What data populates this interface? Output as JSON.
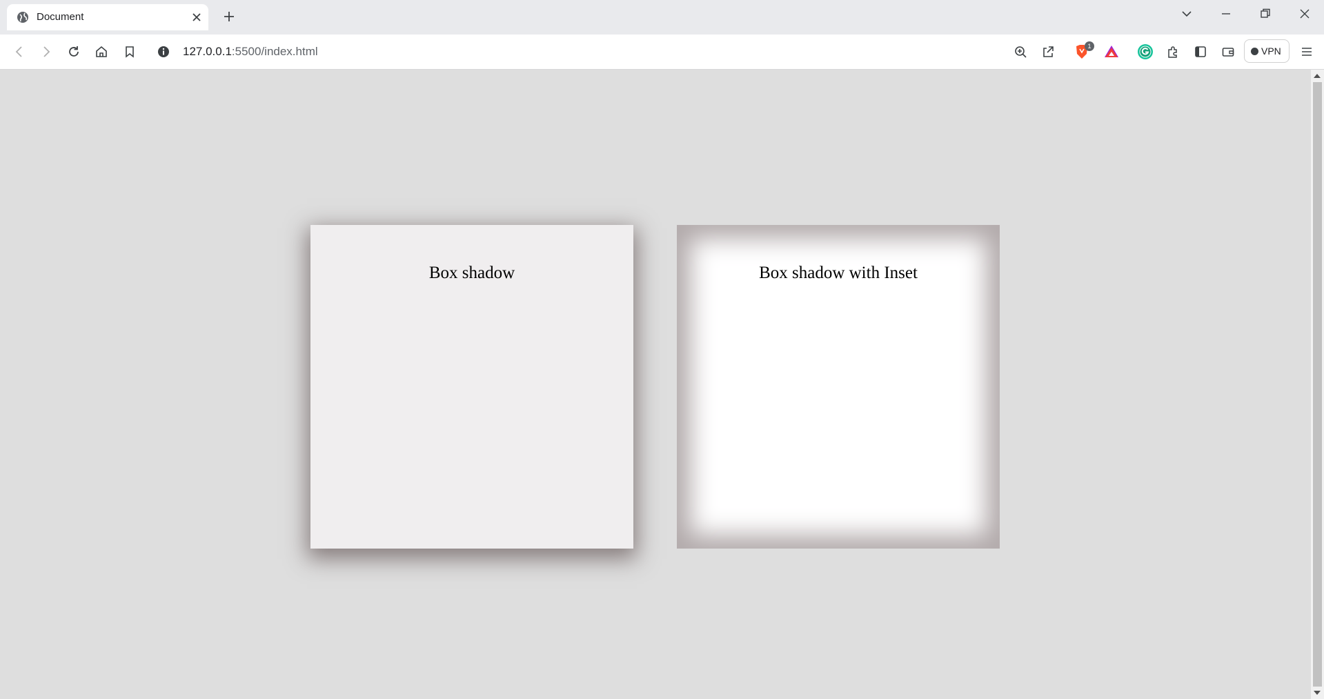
{
  "browser": {
    "tab": {
      "title": "Document"
    },
    "url": {
      "host": "127.0.0.1",
      "path": ":5500/index.html"
    },
    "vpn_label": "VPN",
    "brave_badge": "1"
  },
  "page": {
    "box_shadow_label": "Box shadow",
    "box_inset_label": "Box shadow with Inset"
  },
  "colors": {
    "page_background": "#dedede",
    "box_shadow_fill": "#f0eeef",
    "box_inset_fill": "#ffffff",
    "shadow_color": "#b2aaab"
  }
}
